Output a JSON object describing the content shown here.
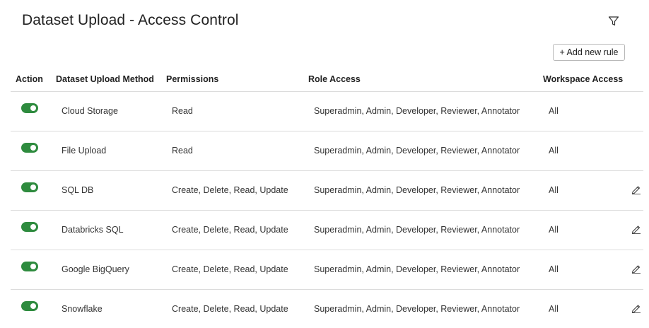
{
  "page": {
    "title": "Dataset Upload - Access Control",
    "add_rule_label": "+ Add new rule",
    "filter_icon": "filter-icon"
  },
  "colors": {
    "toggle_on": "#2e8b3e",
    "border": "#dcdcdc"
  },
  "table": {
    "headers": {
      "action": "Action",
      "method": "Dataset Upload Method",
      "permissions": "Permissions",
      "role_access": "Role Access",
      "workspace_access": "Workspace Access"
    },
    "rows": [
      {
        "enabled": true,
        "method": "Cloud Storage",
        "permissions": "Read",
        "role_access": "Superadmin, Admin, Developer, Reviewer, Annotator",
        "workspace_access": "All",
        "editable": false
      },
      {
        "enabled": true,
        "method": "File Upload",
        "permissions": "Read",
        "role_access": "Superadmin, Admin, Developer, Reviewer, Annotator",
        "workspace_access": "All",
        "editable": false
      },
      {
        "enabled": true,
        "method": "SQL DB",
        "permissions": "Create, Delete, Read, Update",
        "role_access": "Superadmin, Admin, Developer, Reviewer, Annotator",
        "workspace_access": "All",
        "editable": true
      },
      {
        "enabled": true,
        "method": "Databricks SQL",
        "permissions": "Create, Delete, Read, Update",
        "role_access": "Superadmin, Admin, Developer, Reviewer, Annotator",
        "workspace_access": "All",
        "editable": true
      },
      {
        "enabled": true,
        "method": "Google BigQuery",
        "permissions": "Create, Delete, Read, Update",
        "role_access": "Superadmin, Admin, Developer, Reviewer, Annotator",
        "workspace_access": "All",
        "editable": true
      },
      {
        "enabled": true,
        "method": "Snowflake",
        "permissions": "Create, Delete, Read, Update",
        "role_access": "Superadmin, Admin, Developer, Reviewer, Annotator",
        "workspace_access": "All",
        "editable": true
      }
    ]
  }
}
